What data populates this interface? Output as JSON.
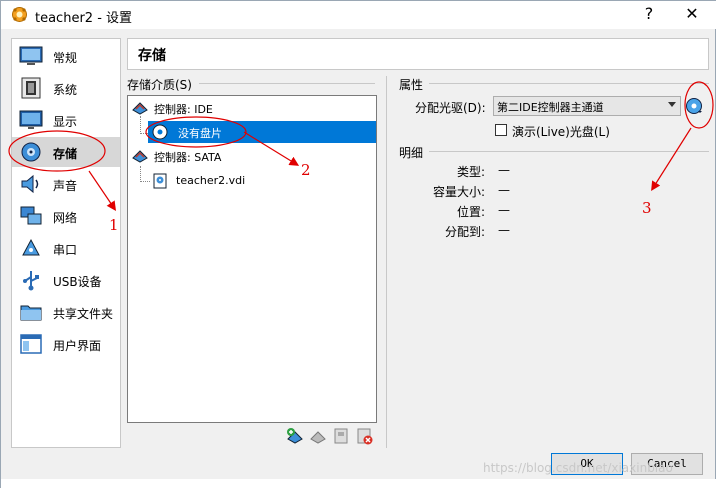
{
  "window": {
    "title": "teacher2 - 设置",
    "help_glyph": "?",
    "close_glyph": "✕"
  },
  "sidebar": {
    "items": [
      {
        "label": "常规",
        "icon": "general-icon"
      },
      {
        "label": "系统",
        "icon": "system-icon"
      },
      {
        "label": "显示",
        "icon": "display-icon"
      },
      {
        "label": "存储",
        "icon": "storage-icon",
        "selected": true
      },
      {
        "label": "声音",
        "icon": "audio-icon"
      },
      {
        "label": "网络",
        "icon": "network-icon"
      },
      {
        "label": "串口",
        "icon": "serial-port-icon"
      },
      {
        "label": "USB设备",
        "icon": "usb-icon"
      },
      {
        "label": "共享文件夹",
        "icon": "shared-folder-icon"
      },
      {
        "label": "用户界面",
        "icon": "user-interface-icon"
      }
    ]
  },
  "header": {
    "title": "存储"
  },
  "storage": {
    "label": "存储介质(S)",
    "tree": [
      {
        "label": "控制器: IDE",
        "type": "controller"
      },
      {
        "label": "没有盘片",
        "type": "optical",
        "selected": true
      },
      {
        "label": "控制器: SATA",
        "type": "controller"
      },
      {
        "label": "teacher2.vdi",
        "type": "disk"
      }
    ]
  },
  "properties": {
    "heading": "属性",
    "drive_label": "分配光驱(D):",
    "drive_value": "第二IDE控制器主通道",
    "live_cd_label": "演示(Live)光盘(L)",
    "live_cd_checked": false
  },
  "details": {
    "heading": "明细",
    "rows": [
      {
        "label": "类型:",
        "value": "—"
      },
      {
        "label": "容量大小:",
        "value": "—"
      },
      {
        "label": "位置:",
        "value": "—"
      },
      {
        "label": "分配到:",
        "value": "—"
      }
    ]
  },
  "buttons": {
    "ok": "OK",
    "cancel": "Cancel"
  },
  "annotations": {
    "n1": "1",
    "n2": "2",
    "n3": "3"
  },
  "watermark": "https://blog.csdn.net/xiaxinbiao",
  "colors": {
    "selection": "#0078d7",
    "annotation": "#e00000"
  }
}
